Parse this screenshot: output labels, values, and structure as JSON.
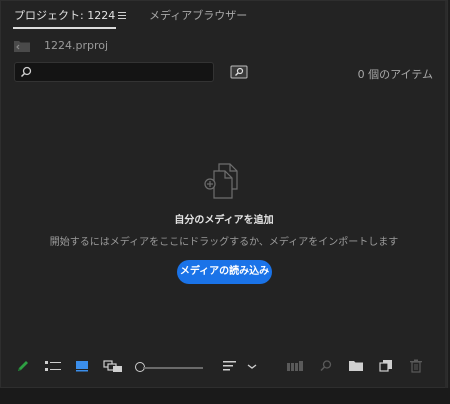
{
  "tabs": {
    "project_label": "プロジェクト: 1224",
    "media_browser_label": "メディアブラウザー"
  },
  "project": {
    "file_name": "1224.prproj"
  },
  "search": {
    "value": "",
    "placeholder": ""
  },
  "status": {
    "item_count": "0 個のアイテム"
  },
  "empty_state": {
    "title": "自分のメディアを追加",
    "description": "開始するにはメディアをここにドラッグするか、メディアをインポートします",
    "import_button": "メディアの読み込み"
  },
  "colors": {
    "accent": "#1a73e8",
    "pencil": "#2ea043",
    "active_view": "#3b8eea",
    "panel_bg": "#232323"
  },
  "toolbar": {
    "icons": [
      "pencil-icon",
      "list-view-icon",
      "icon-view-icon",
      "freeform-view-icon",
      "zoom-slider",
      "sort-icon",
      "chevron-down-icon",
      "automate-to-sequence-icon",
      "find-icon",
      "new-bin-icon",
      "new-item-icon",
      "trash-icon"
    ]
  }
}
